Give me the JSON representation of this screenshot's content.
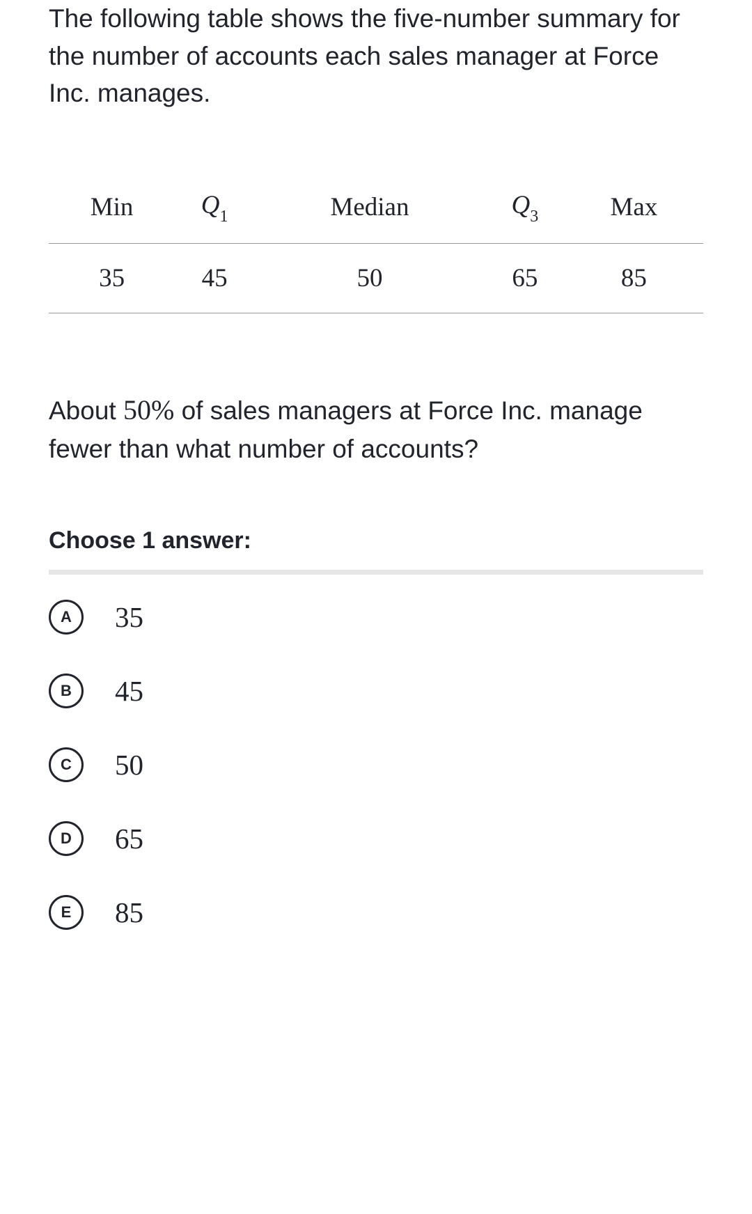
{
  "intro": "The following table shows the five-number summary for the number of accounts each sales manager at Force Inc. manages.",
  "table": {
    "headers": {
      "min": "Min",
      "q1_base": "Q",
      "q1_sub": "1",
      "median": "Median",
      "q3_base": "Q",
      "q3_sub": "3",
      "max": "Max"
    },
    "values": {
      "min": "35",
      "q1": "45",
      "median": "50",
      "q3": "65",
      "max": "85"
    }
  },
  "question": {
    "part1": "About ",
    "percent": "50%",
    "part2": " of sales managers at Force Inc. manage fewer than what number of accounts?"
  },
  "choose_label": "Choose 1 answer:",
  "options": [
    {
      "letter": "A",
      "value": "35"
    },
    {
      "letter": "B",
      "value": "45"
    },
    {
      "letter": "C",
      "value": "50"
    },
    {
      "letter": "D",
      "value": "65"
    },
    {
      "letter": "E",
      "value": "85"
    }
  ]
}
